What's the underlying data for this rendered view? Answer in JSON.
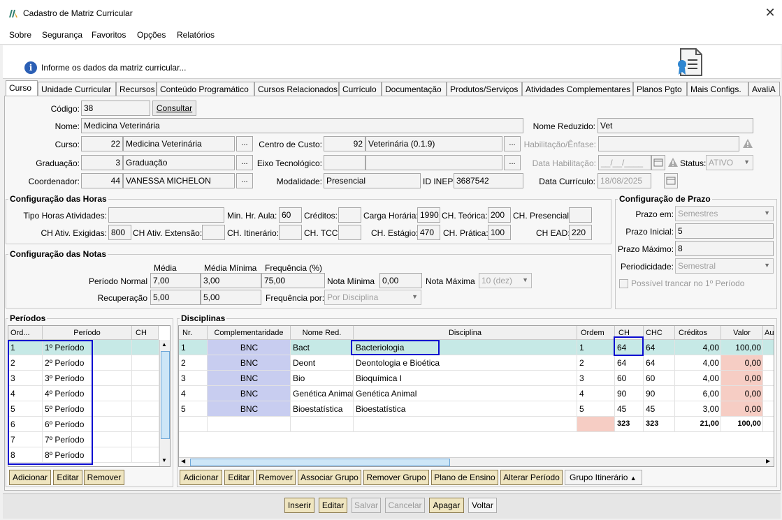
{
  "window": {
    "title": "Cadastro de Matriz Curricular",
    "close": "✕"
  },
  "menu": [
    "Sobre",
    "Segurança",
    "Favoritos",
    "Opções",
    "Relatórios"
  ],
  "info": {
    "text": "Informe os dados da matriz curricular..."
  },
  "tabs": [
    "Curso",
    "Unidade Curricular",
    "Recursos",
    "Conteúdo Programático",
    "Cursos Relacionados",
    "Currículo",
    "Documentação",
    "Produtos/Serviços",
    "Atividades Complementares",
    "Planos Pgto",
    "Mais Configs.",
    "AvaliA"
  ],
  "form": {
    "codigo_label": "Código:",
    "codigo": "38",
    "consultar": "Consultar",
    "nome_label": "Nome:",
    "nome": "Medicina Veterinária",
    "nome_reduzido_label": "Nome Reduzido:",
    "nome_reduzido": "Vet",
    "curso_label": "Curso:",
    "curso_id": "22",
    "curso": "Medicina Veterinária",
    "centro_custo_label": "Centro de Custo:",
    "centro_custo_id": "92",
    "centro_custo": "Veterinária (0.1.9)",
    "habilitacao_label": "Habilitação/Ênfase:",
    "graduacao_label": "Graduação:",
    "graduacao_id": "3",
    "graduacao": "Graduação",
    "eixo_label": "Eixo Tecnológico:",
    "data_habilitacao_label": "Data Habilitação:",
    "data_habilitacao": "__/__/____",
    "status_label": "Status:",
    "status": "ATIVO",
    "coordenador_label": "Coordenador:",
    "coordenador_id": "44",
    "coordenador": "VANESSA MICHELON",
    "modalidade_label": "Modalidade:",
    "modalidade": "Presencial",
    "id_inep_label": "ID INEP:",
    "id_inep": "3687542",
    "data_curriculo_label": "Data Currículo:",
    "data_curriculo": "18/08/2025",
    "ellipsis": "..."
  },
  "horas": {
    "title": "Configuração das Horas",
    "tipo_horas_label": "Tipo Horas Atividades:",
    "tipo_horas": "",
    "min_hr_aula_label": "Min. Hr. Aula:",
    "min_hr_aula": "60",
    "creditos_label": "Créditos:",
    "creditos": "",
    "carga_horaria_label": "Carga Horária:",
    "carga_horaria": "1990",
    "ch_teorica_label": "CH. Teórica:",
    "ch_teorica": "200",
    "ch_presencial_label": "CH. Presencial:",
    "ch_presencial": "",
    "ch_ativ_exigidas_label": "CH Ativ. Exigidas:",
    "ch_ativ_exigidas": "800",
    "ch_ativ_extensao_label": "CH Ativ. Extensão:",
    "ch_ativ_extensao": "",
    "ch_itinerario_label": "CH. Itinerário:",
    "ch_itinerario": "",
    "ch_tcc_label": "CH. TCC:",
    "ch_tcc": "",
    "ch_estagio_label": "CH. Estágio:",
    "ch_estagio": "470",
    "ch_pratica_label": "CH. Prática:",
    "ch_pratica": "100",
    "ch_ead_label": "CH EAD:",
    "ch_ead": "220"
  },
  "notas": {
    "title": "Configuração das Notas",
    "media_label": "Média",
    "media_minima_label": "Média Mínima",
    "frequencia_label": "Frequência (%)",
    "periodo_normal_label": "Período Normal",
    "pn_media": "7,00",
    "pn_media_minima": "3,00",
    "pn_frequencia": "75,00",
    "nota_minima_label": "Nota Mínima",
    "nota_minima": "0,00",
    "nota_maxima_label": "Nota Máxima",
    "nota_maxima": "10 (dez)",
    "recuperacao_label": "Recuperação",
    "rec_media": "5,00",
    "rec_media_minima": "5,00",
    "frequencia_por_label": "Frequência por:",
    "frequencia_por": "Por Disciplina"
  },
  "prazo": {
    "title": "Configuração de Prazo",
    "prazo_em_label": "Prazo em:",
    "prazo_em": "Semestres",
    "prazo_inicial_label": "Prazo Inicial:",
    "prazo_inicial": "5",
    "prazo_maximo_label": "Prazo Máximo:",
    "prazo_maximo": "8",
    "periodicidade_label": "Periodicidade:",
    "periodicidade": "Semestral",
    "trancar_label": "Possível trancar no 1º Período"
  },
  "periodos": {
    "title": "Períodos",
    "headers": [
      "Ord...",
      "Período",
      "CH"
    ],
    "rows": [
      {
        "ord": "1",
        "periodo": "1º Período"
      },
      {
        "ord": "2",
        "periodo": "2º Período"
      },
      {
        "ord": "3",
        "periodo": "3º Período"
      },
      {
        "ord": "4",
        "periodo": "4º Período"
      },
      {
        "ord": "5",
        "periodo": "5º Período"
      },
      {
        "ord": "6",
        "periodo": "6º Período"
      },
      {
        "ord": "7",
        "periodo": "7º Período"
      },
      {
        "ord": "8",
        "periodo": "8º Período"
      }
    ],
    "buttons": [
      "Adicionar",
      "Editar",
      "Remover"
    ]
  },
  "disciplinas": {
    "title": "Disciplinas",
    "headers": [
      "Nr.",
      "Complementaridade",
      "Nome Red.",
      "Disciplina",
      "Ordem",
      "CH",
      "CHC",
      "Créditos",
      "Valor",
      "Au"
    ],
    "rows": [
      {
        "nr": "1",
        "comp": "BNC",
        "nome_red": "Bact",
        "disciplina": "Bacteriologia",
        "ordem": "1",
        "ch": "64",
        "chc": "64",
        "creditos": "4,00",
        "valor": "100,00"
      },
      {
        "nr": "2",
        "comp": "BNC",
        "nome_red": "Deont",
        "disciplina": "Deontologia e Bioética",
        "ordem": "2",
        "ch": "64",
        "chc": "64",
        "creditos": "4,00",
        "valor": "0,00"
      },
      {
        "nr": "3",
        "comp": "BNC",
        "nome_red": "Bio",
        "disciplina": "Bioquímica I",
        "ordem": "3",
        "ch": "60",
        "chc": "60",
        "creditos": "4,00",
        "valor": "0,00"
      },
      {
        "nr": "4",
        "comp": "BNC",
        "nome_red": "Genética Animal",
        "disciplina": "Genética Animal",
        "ordem": "4",
        "ch": "90",
        "chc": "90",
        "creditos": "6,00",
        "valor": "0,00"
      },
      {
        "nr": "5",
        "comp": "BNC",
        "nome_red": "Bioestatística",
        "disciplina": "Bioestatística",
        "ordem": "5",
        "ch": "45",
        "chc": "45",
        "creditos": "3,00",
        "valor": "0,00"
      }
    ],
    "totals": {
      "ch": "323",
      "chc": "323",
      "creditos": "21,00",
      "valor": "100,00"
    },
    "buttons": [
      "Adicionar",
      "Editar",
      "Remover",
      "Associar Grupo",
      "Remover Grupo",
      "Plano de Ensino",
      "Alterar Período",
      "Grupo Itinerário"
    ]
  },
  "footer": {
    "buttons": [
      "Inserir",
      "Editar",
      "Salvar",
      "Cancelar",
      "Apagar",
      "Voltar"
    ]
  },
  "colors": {
    "selected_row": "#c6e9e6",
    "comp_cell": "#c8cdf0",
    "valor_zero": "#f6cdc4",
    "highlight": "#0b0bd0"
  }
}
